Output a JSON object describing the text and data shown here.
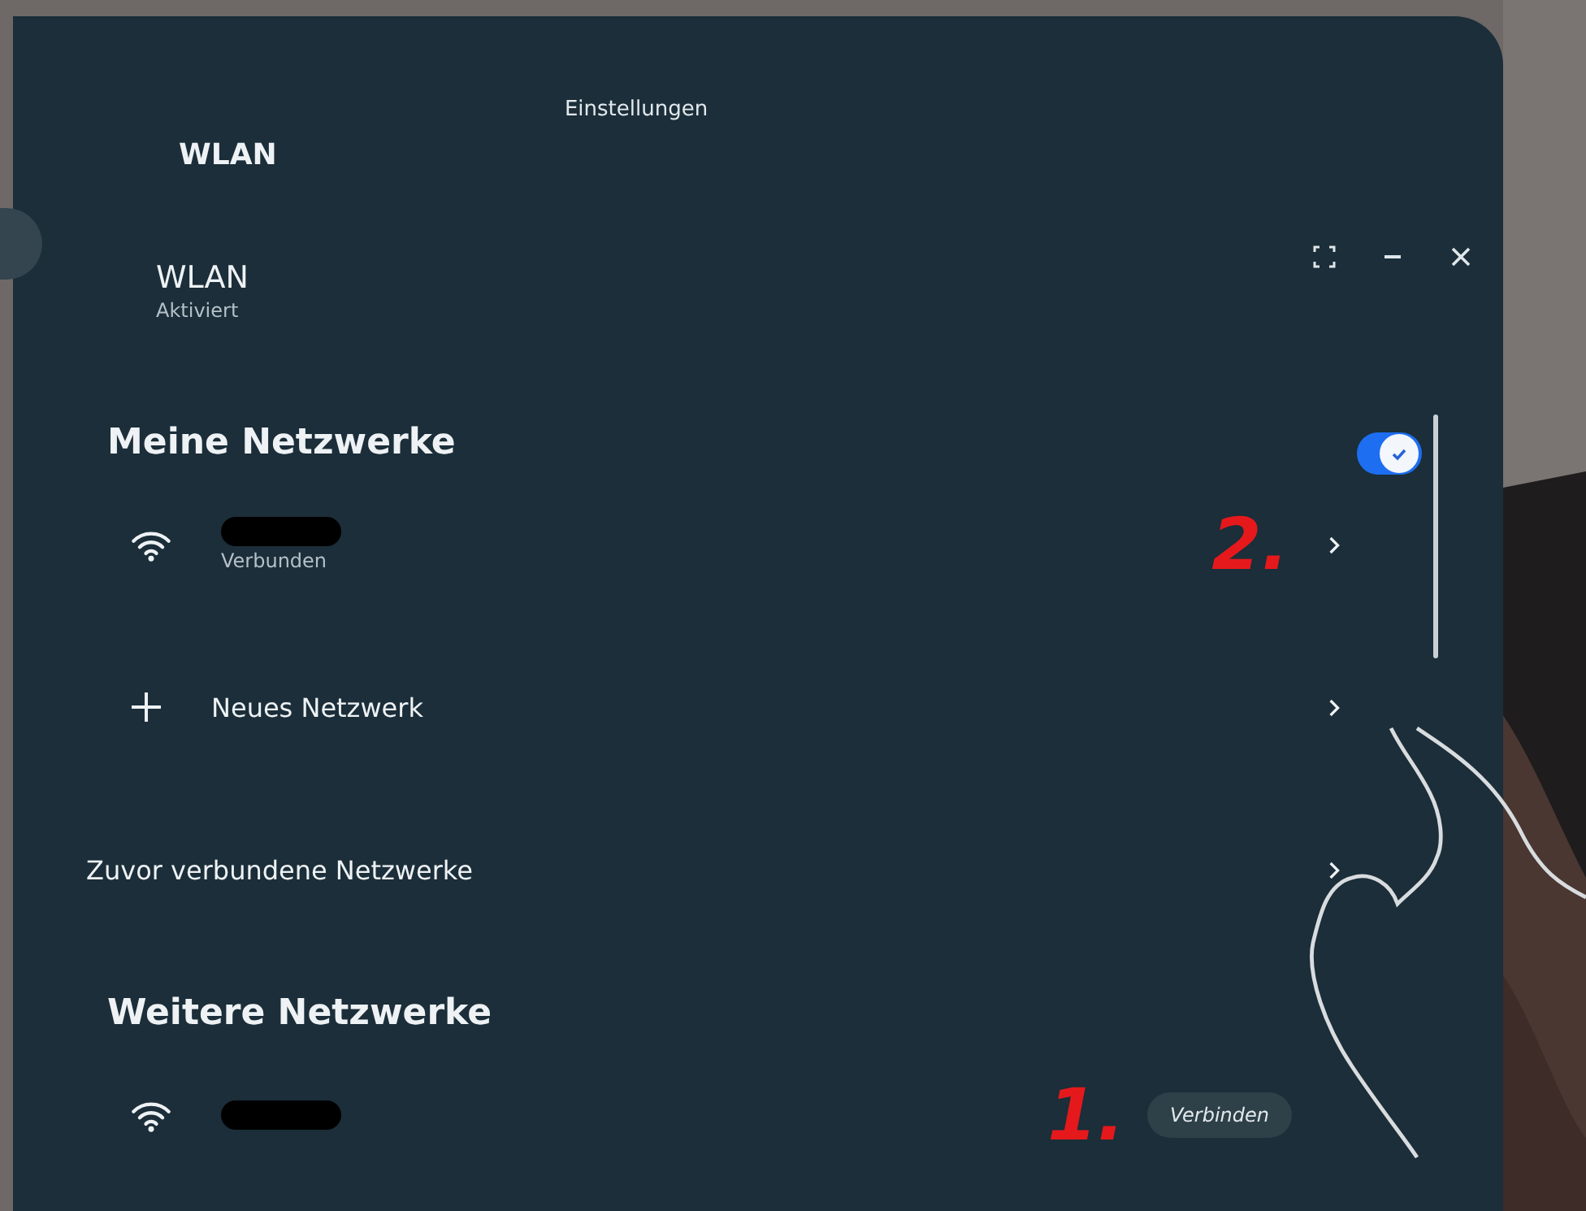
{
  "window": {
    "title": "Einstellungen"
  },
  "heading": "WLAN",
  "wifi": {
    "label": "WLAN",
    "status": "Aktiviert",
    "on": true
  },
  "sections": [
    {
      "title": "Meine Netzwerke",
      "items": [
        {
          "kind": "network",
          "status": "Verbunden",
          "annotation": "2."
        },
        {
          "kind": "add",
          "label": "Neues Netzwerk"
        },
        {
          "kind": "link",
          "label": "Zuvor verbundene Netzwerke"
        }
      ]
    },
    {
      "title": "Weitere Netzwerke",
      "items": [
        {
          "kind": "network",
          "action": "Verbinden",
          "annotation": "1."
        }
      ]
    }
  ]
}
